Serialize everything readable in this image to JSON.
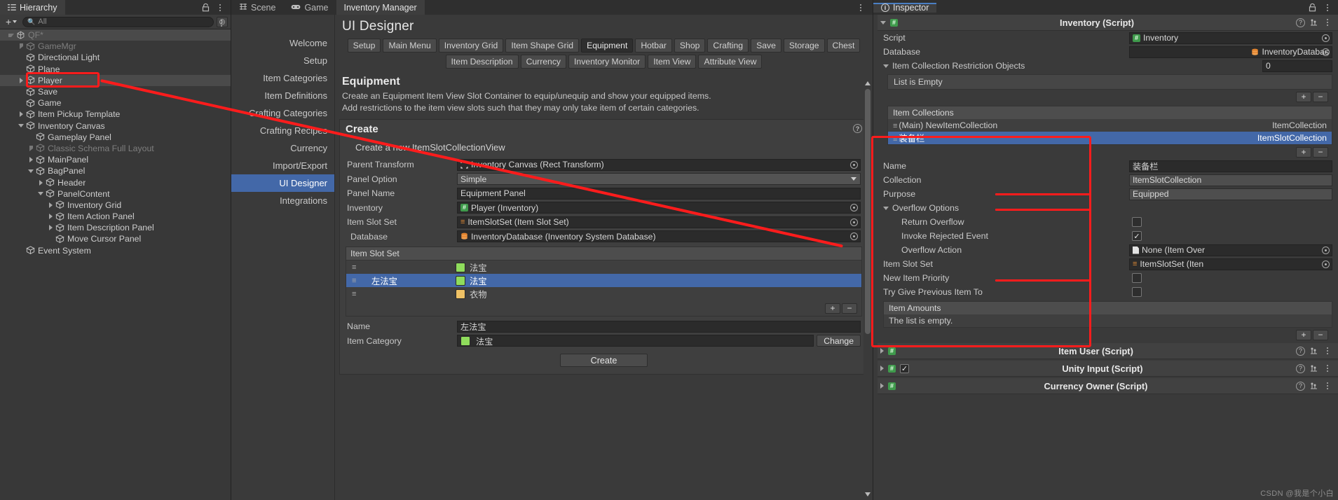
{
  "hierarchy": {
    "tab_label": "Hierarchy",
    "toolbar": {
      "add_label": "+",
      "search_placeholder": "All",
      "search_value": ""
    },
    "rows": [
      {
        "label": "QF*",
        "depth": 1,
        "twisty": "down",
        "icon": "unity-icon",
        "selected": true,
        "dim": true
      },
      {
        "label": "GameMgr",
        "depth": 2,
        "twisty": "right",
        "icon": "cube-icon",
        "selected": false,
        "dim": true
      },
      {
        "label": "Directional Light",
        "depth": 2,
        "twisty": "none",
        "icon": "cube-icon",
        "selected": false,
        "dim": false
      },
      {
        "label": "Plane",
        "depth": 2,
        "twisty": "none",
        "icon": "cube-icon",
        "selected": false,
        "dim": false
      },
      {
        "label": "Player",
        "depth": 2,
        "twisty": "right",
        "icon": "cube-icon",
        "selected": true,
        "dim": false
      },
      {
        "label": "Save",
        "depth": 2,
        "twisty": "none",
        "icon": "cube-icon",
        "selected": false,
        "dim": false
      },
      {
        "label": "Game",
        "depth": 2,
        "twisty": "none",
        "icon": "cube-icon",
        "selected": false,
        "dim": false
      },
      {
        "label": "Item Pickup Template",
        "depth": 2,
        "twisty": "right",
        "icon": "cube-icon",
        "selected": false,
        "dim": false
      },
      {
        "label": "Inventory Canvas",
        "depth": 2,
        "twisty": "down",
        "icon": "cube-icon",
        "selected": false,
        "dim": false
      },
      {
        "label": "Gameplay Panel",
        "depth": 3,
        "twisty": "none",
        "icon": "cube-icon",
        "selected": false,
        "dim": false
      },
      {
        "label": "Classic Schema Full Layout",
        "depth": 3,
        "twisty": "right",
        "icon": "cube-icon",
        "selected": false,
        "dim": true
      },
      {
        "label": "MainPanel",
        "depth": 3,
        "twisty": "right",
        "icon": "cube-icon",
        "selected": false,
        "dim": false
      },
      {
        "label": "BagPanel",
        "depth": 3,
        "twisty": "down",
        "icon": "cube-icon",
        "selected": false,
        "dim": false
      },
      {
        "label": "Header",
        "depth": 4,
        "twisty": "right",
        "icon": "cube-icon",
        "selected": false,
        "dim": false
      },
      {
        "label": "PanelContent",
        "depth": 4,
        "twisty": "down",
        "icon": "cube-icon",
        "selected": false,
        "dim": false
      },
      {
        "label": "Inventory Grid",
        "depth": 5,
        "twisty": "right",
        "icon": "cube-icon",
        "selected": false,
        "dim": false
      },
      {
        "label": "Item Action Panel",
        "depth": 5,
        "twisty": "right",
        "icon": "cube-icon",
        "selected": false,
        "dim": false
      },
      {
        "label": "Item Description Panel",
        "depth": 5,
        "twisty": "right",
        "icon": "cube-icon",
        "selected": false,
        "dim": false
      },
      {
        "label": "Move Cursor Panel",
        "depth": 5,
        "twisty": "none",
        "icon": "cube-icon",
        "selected": false,
        "dim": false
      },
      {
        "label": "Event System",
        "depth": 2,
        "twisty": "none",
        "icon": "cube-icon",
        "selected": false,
        "dim": false
      }
    ]
  },
  "center": {
    "tabs": [
      {
        "label": "Scene",
        "icon": "scene-icon",
        "active": false
      },
      {
        "label": "Game",
        "icon": "game-icon",
        "active": false
      },
      {
        "label": "Inventory Manager",
        "icon": "none",
        "active": true
      }
    ],
    "nav": [
      {
        "label": "Welcome",
        "selected": false
      },
      {
        "label": "Setup",
        "selected": false
      },
      {
        "label": "Item Categories",
        "selected": false
      },
      {
        "label": "Item Definitions",
        "selected": false
      },
      {
        "label": "Crafting Categories",
        "selected": false
      },
      {
        "label": "Crafting Recipes",
        "selected": false
      },
      {
        "label": "Currency",
        "selected": false
      },
      {
        "label": "Import/Export",
        "selected": false
      },
      {
        "label": "UI Designer",
        "selected": true
      },
      {
        "label": "Integrations",
        "selected": false
      }
    ],
    "page_title": "UI Designer",
    "chips_row1": [
      {
        "label": "Setup",
        "selected": false
      },
      {
        "label": "Main Menu",
        "selected": false
      },
      {
        "label": "Inventory Grid",
        "selected": false
      },
      {
        "label": "Item Shape Grid",
        "selected": false
      },
      {
        "label": "Equipment",
        "selected": true
      },
      {
        "label": "Hotbar",
        "selected": false
      },
      {
        "label": "Shop",
        "selected": false
      },
      {
        "label": "Crafting",
        "selected": false
      },
      {
        "label": "Save",
        "selected": false
      },
      {
        "label": "Storage",
        "selected": false
      },
      {
        "label": "Chest",
        "selected": false
      }
    ],
    "chips_row2": [
      {
        "label": "Item Description",
        "selected": false
      },
      {
        "label": "Currency",
        "selected": false
      },
      {
        "label": "Inventory Monitor",
        "selected": false
      },
      {
        "label": "Item View",
        "selected": false
      },
      {
        "label": "Attribute View",
        "selected": false
      }
    ],
    "section_title": "Equipment",
    "section_desc_1": "Create an Equipment Item View Slot Container to equip/unequip and show your equipped items.",
    "section_desc_2": "Add restrictions to the item view slots such that they may only take item of certain categories.",
    "create": {
      "header": "Create",
      "help_icon": "help-icon",
      "subtitle": "Create a new ItemSlotCollectionView",
      "fields": [
        {
          "label": "Parent Transform",
          "value": "Inventory Canvas (Rect Transform)",
          "icon": "rect-transform-icon",
          "widget": "object"
        },
        {
          "label": "Panel Option",
          "value": "Simple",
          "icon": "none",
          "widget": "dropdown"
        },
        {
          "label": "Panel Name",
          "value": "Equipment Panel",
          "icon": "none",
          "widget": "text"
        },
        {
          "label": "Inventory",
          "value": "Player (Inventory)",
          "icon": "script-icon",
          "widget": "object"
        },
        {
          "label": "Item Slot Set",
          "value": "ItemSlotSet (Item Slot Set)",
          "icon": "slotset-icon",
          "widget": "object"
        },
        {
          "label": "Database",
          "value": "InventoryDatabase (Inventory System Database)",
          "icon": "database-icon",
          "widget": "object",
          "indent": true
        }
      ],
      "slot_list_header": "Item Slot Set",
      "slot_rows": [
        {
          "grip": "=",
          "name": "",
          "category": "法宝",
          "color": "#8fdc5c",
          "selected": false
        },
        {
          "grip": "=",
          "name": "左法宝",
          "category": "法宝",
          "color": "#8fdc5c",
          "selected": true
        },
        {
          "grip": "=",
          "name": "",
          "category": "衣物",
          "color": "#efc165",
          "selected": false
        }
      ],
      "list_add_label": "+",
      "list_remove_label": "−",
      "name_label": "Name",
      "name_value": "左法宝",
      "category_label": "Item Category",
      "category_value": "法宝",
      "category_color": "#8fdc5c",
      "change_label": "Change",
      "create_button": "Create"
    }
  },
  "inspector": {
    "tab_label": "Inspector",
    "lock_icon": "lock-icon",
    "components": [
      {
        "title": "Inventory (Script)",
        "icon": "script-icon",
        "has_checkbox": false,
        "checked": false,
        "expanded": true
      },
      {
        "title": "Item User (Script)",
        "icon": "script-icon",
        "has_checkbox": false,
        "checked": false,
        "expanded": false
      },
      {
        "title": "Unity Input (Script)",
        "icon": "script-icon",
        "has_checkbox": true,
        "checked": true,
        "expanded": false
      },
      {
        "title": "Currency Owner (Script)",
        "icon": "script-icon",
        "has_checkbox": false,
        "checked": false,
        "expanded": false
      }
    ],
    "inventory": {
      "script_label": "Script",
      "script_value": "Inventory",
      "database_label": "Database",
      "database_value": "InventoryDatabas",
      "restriction_label": "Item Collection Restriction Objects",
      "restriction_count": "0",
      "restriction_empty": "List is Empty",
      "collections_header": "Item Collections",
      "collections": [
        {
          "name": "(Main) NewItemCollection",
          "type": "ItemCollection",
          "selected": false
        },
        {
          "name": "装备栏",
          "type": "ItemSlotCollection",
          "selected": true
        }
      ],
      "add_label": "+",
      "remove_label": "−",
      "name_label": "Name",
      "name_value": "装备栏",
      "collection_label": "Collection",
      "collection_value": "ItemSlotCollection",
      "purpose_label": "Purpose",
      "purpose_value": "Equipped",
      "overflow_label": "Overflow Options",
      "return_overflow_label": "Return Overflow",
      "return_overflow_checked": false,
      "invoke_rejected_label": "Invoke Rejected Event",
      "invoke_rejected_checked": true,
      "overflow_action_label": "Overflow Action",
      "overflow_action_value": "None (Item Over",
      "item_slot_set_label": "Item Slot Set",
      "item_slot_set_value": "ItemSlotSet (Iten",
      "new_item_priority_label": "New Item Priority",
      "new_item_priority_checked": false,
      "try_give_label": "Try Give Previous Item To",
      "try_give_checked": false,
      "item_amounts_header": "Item Amounts",
      "item_amounts_empty": "The list is empty."
    }
  },
  "watermark": "CSDN @我是个小白"
}
